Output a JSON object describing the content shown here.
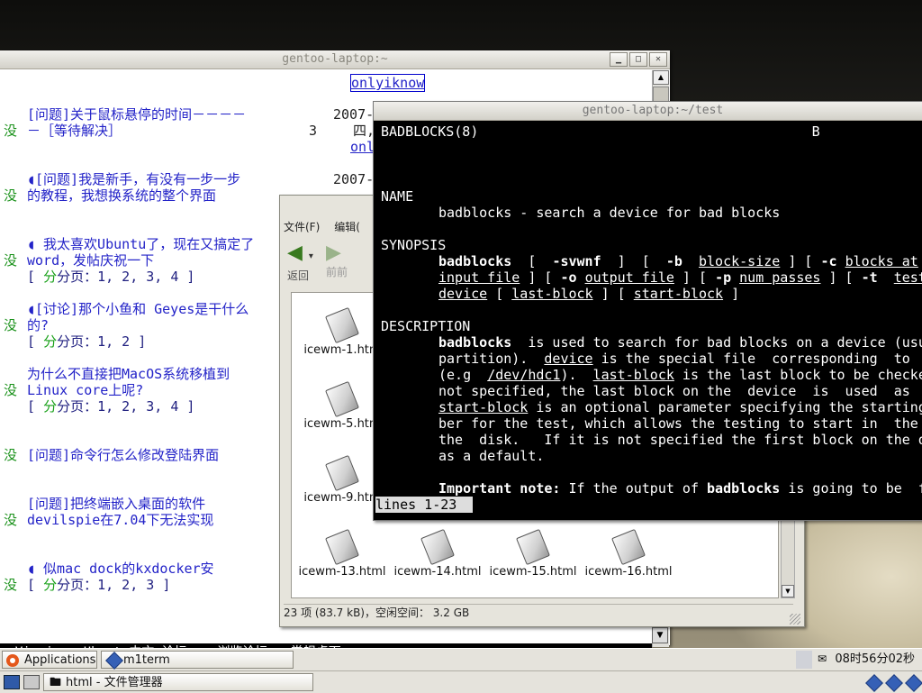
{
  "w3m": {
    "title": "gentoo-laptop:~",
    "top_link": "onlyiknow",
    "rows": [
      {
        "mei": "没",
        "line1": "[问题]关于鼠标悬停的时间－－－－",
        "line2": "－［等待解决］",
        "num": "3",
        "date": "2007-",
        "extra1": "四,",
        "extra2": "onl"
      },
      {
        "mei": "没",
        "line1": "◖[问题]我是新手，有没有一步一步",
        "line2": "的教程，我想换系统的整个界面",
        "date": "2007-"
      },
      {
        "mei": "没",
        "line1": "◖ 我太喜欢Ubuntu了，现在又搞定了",
        "line2": "word，发帖庆祝一下",
        "pages_kw": "分",
        "pages_label": "分页：",
        "pages": "1, 2, 3, 4 ]"
      },
      {
        "mei": "没",
        "line1": "◖[讨论]那个小鱼和 Geyes是干什么",
        "line2": "的?",
        "pages_kw": "分",
        "pages_label": "分页：",
        "pages": "1, 2 ]"
      },
      {
        "mei": "没",
        "line1": "为什么不直接把MacOS系统移植到",
        "line2": "Linux core上呢?",
        "pages_kw": "分",
        "pages_label": "分页：",
        "pages": "1, 2, 3, 4 ]"
      },
      {
        "mei": "没",
        "line1": "[问题]命令行怎么修改登陆界面"
      },
      {
        "mei": "没",
        "line1": "[问题]把终端嵌入桌面的软件",
        "line2": "devilspie在7.04下无法实现"
      },
      {
        "mei": "没",
        "line1": "◖   似mac dock的kxdocker安",
        "pages_kw": "分",
        "pages_label": "分页：",
        "pages": "1, 2, 3 ]"
      }
    ],
    "status": "↑↓Viewing <Ubuntu中文 论坛 :: 浏览论坛 - 常规桌面>"
  },
  "file_manager": {
    "menu": [
      "文件(F)",
      "编辑("
    ],
    "toolbar": {
      "back_label": "返回",
      "forward_label": "前前"
    },
    "files": [
      "icewm-1.htm",
      "icewm-5.htm",
      "icewm-9.htm",
      "icewm-13.html",
      "icewm-14.html",
      "icewm-15.html",
      "icewm-16.html"
    ],
    "status": "23 项 (83.7 kB)，空闲空间： 3.2 GB"
  },
  "terminal": {
    "title": "gentoo-laptop:~/test",
    "header_left": "BADBLOCKS(8)",
    "header_right": "B",
    "name_heading": "NAME",
    "name_text": "badblocks - search a device for bad blocks",
    "synopsis_heading": "SYNOPSIS",
    "description_heading": "DESCRIPTION",
    "pager_status": "lines 1-23"
  },
  "panel_top": {
    "applications": "Applications",
    "task": "m1term",
    "clock": "08时56分02秒"
  },
  "panel_bottom": {
    "task": "html - 文件管理器"
  }
}
